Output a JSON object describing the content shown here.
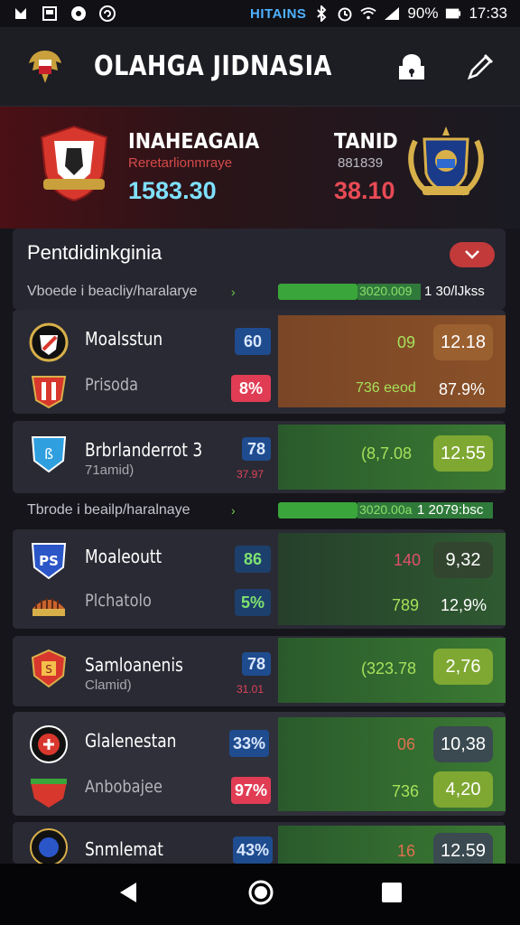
{
  "statusbar": {
    "network": "HITAINS",
    "battery": "90%",
    "time": "17:33"
  },
  "appbar": {
    "title": "OLAHGA JIDNASIA"
  },
  "match": {
    "home": {
      "name": "INAHEAGAIA",
      "subtitle": "Reretarlionmraye",
      "score": "1583.30"
    },
    "away": {
      "name": "TANID",
      "subtitle": "881839",
      "score": "38.10"
    }
  },
  "panel": {
    "title": "Pentdidinkginia"
  },
  "filters": [
    {
      "label": "Vboede i beacliy/haralarye",
      "bar_text": "3020.009",
      "count": "1 30/lJkss"
    },
    {
      "label": "Tbrode i beailp/haralnaye",
      "bar_text": "3020.00a",
      "count": "1 2079:bsc"
    }
  ],
  "rows": [
    {
      "name": "Moalsstun",
      "badge": "60",
      "odds_value": "09",
      "odds_box": "12.18"
    },
    {
      "name": "Prisoda",
      "badge": "8%",
      "odds_value": "736 eeod",
      "odds_box": "87.9%"
    },
    {
      "name": "Brbrlanderrot 3",
      "sub": "71amid)",
      "badge": "78",
      "small": "37.97",
      "odds_value": "(8,7.08",
      "odds_box": "12.55"
    },
    {
      "name": "Moaleoutt",
      "badge": "86",
      "odds_value": "140",
      "odds_box": "9,32"
    },
    {
      "name": "Plchatolo",
      "badge": "5%",
      "odds_value": "789",
      "odds_box": "12,9%"
    },
    {
      "name": "Samloanenis",
      "sub": "Clamid)",
      "badge": "78",
      "small": "31.01",
      "odds_value": "(323.78",
      "odds_box": "2,76"
    },
    {
      "name": "Glalenestan",
      "badge": "33%",
      "odds_value": "06",
      "odds_box": "10,38"
    },
    {
      "name": "Anbobajee",
      "badge": "97%",
      "odds_value": "736",
      "odds_box": "4,20"
    },
    {
      "name": "Snmlemat",
      "badge": "43%",
      "odds_value": "16",
      "odds_box": "12.59"
    }
  ],
  "colors": {
    "accent_green": "#6fd34a",
    "accent_red": "#e03d54",
    "accent_blue": "#1f4c8f",
    "odds_orange": "#8a5128"
  }
}
